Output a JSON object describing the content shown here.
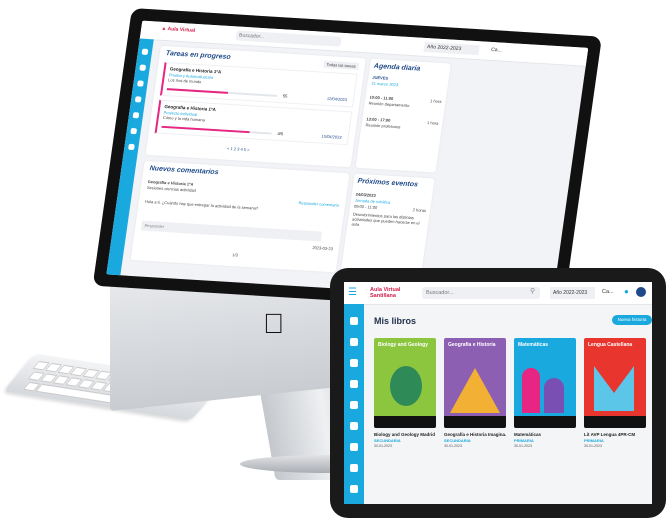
{
  "desktop": {
    "topbar": {
      "search_placeholder": "Buscador...",
      "year": "Año 2022-2023",
      "user": "Ca..."
    },
    "tareas_title": "Tareas en progreso",
    "filter_label": "Todas las tareas",
    "tasks": [
      {
        "subject": "Geografía e Historia 1ºA",
        "type": "Prueba y Autoevaluación",
        "name": "Los ríos de mundo",
        "percent": "55",
        "progress": 0.55,
        "date": "12/04/2023"
      },
      {
        "subject": "Geografía e Historia 1ºA",
        "type": "Proyecto individual",
        "name": "Cómo y la vida humana",
        "percent": "4/5",
        "progress": 0.8,
        "date": "15/04/2023"
      }
    ],
    "pagination": "< 1 2 3 4 5 >",
    "agenda_title": "Agenda diaria",
    "agenda_day": "JUEVES",
    "agenda_date": "21 marzo 2023",
    "agenda_items": [
      {
        "time": "10:00 - 11:00",
        "label": "Reunión departamento",
        "tag": "1 hora"
      },
      {
        "time": "13:00 - 17:00",
        "label": "Reunión profesores",
        "tag": "1 hora"
      }
    ],
    "comments_title": "Nuevos comentarios",
    "comment_subject": "Geografía e Historia 1ºA",
    "comment_sub": "Sesiones ciencias actividad",
    "comment_text": "Hola a ti, ¿Cuándo hay que entregar la actividad de la semana?",
    "reply_link": "Responder comentario",
    "comment_placeholder": "Responder",
    "comment_date": "2023-03-23",
    "comment_page": "1/3",
    "events_title": "Próximos eventos",
    "event_date": "24/03/2023",
    "event_name": "Jornada de robótica",
    "event_time": "09:00 - 11:00",
    "event_note": "Descubrimientos para las distintas actividades que pueden hacerse en el aula",
    "event_tag": "2 horas"
  },
  "tablet": {
    "logo": "Aula Virtual Santillana",
    "search_placeholder": "Buscador...",
    "year": "Año 2022-2023",
    "user": "Ca...",
    "page_title": "Mis libros",
    "new_button": "Nueva historia",
    "books": [
      {
        "cover_title": "Biology and Geology",
        "name": "Biology and Geology Madrid",
        "level": "SECUNDARIA",
        "date": "30-01-2023",
        "color": "#8cc63f"
      },
      {
        "cover_title": "Geografía e Historia",
        "name": "Geografía e Historia Imagina...",
        "level": "SECUNDARIA",
        "date": "30-01-2023",
        "color": "#8d5fb3"
      },
      {
        "cover_title": "Matemáticas",
        "name": "Matemáticas",
        "level": "PRIMARIA",
        "date": "30-01-2023",
        "color": "#1aa9df"
      },
      {
        "cover_title": "Lengua Castellana",
        "name": "Lit AVP Lengua 4PR-CM",
        "level": "PRIMARIA",
        "date": "30-01-2023",
        "color": "#e8362f"
      }
    ]
  }
}
